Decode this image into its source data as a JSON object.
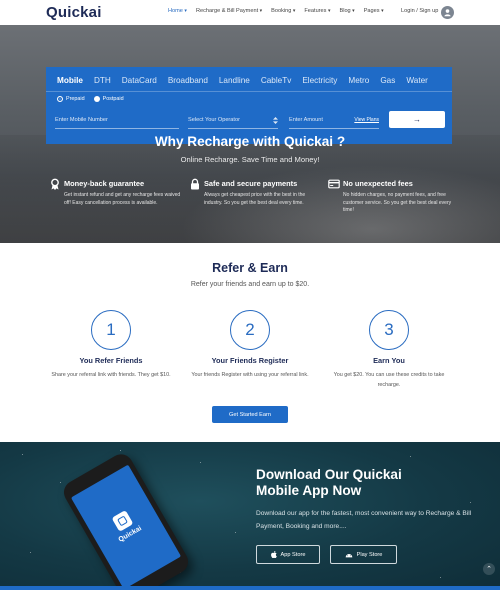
{
  "header": {
    "logo": "Quickai",
    "nav": [
      {
        "label": "Home",
        "caret": "▾",
        "active": true
      },
      {
        "label": "Recharge & Bill Payment",
        "caret": "▾"
      },
      {
        "label": "Booking",
        "caret": "▾"
      },
      {
        "label": "Features",
        "caret": "▾"
      },
      {
        "label": "Blog",
        "caret": "▾"
      },
      {
        "label": "Pages",
        "caret": "▾"
      }
    ],
    "login": "Login / Sign up"
  },
  "recharge_panel": {
    "tabs": [
      "Mobile",
      "DTH",
      "DataCard",
      "Broadband",
      "Landline",
      "CableTv",
      "Electricity",
      "Metro",
      "Gas",
      "Water"
    ],
    "active_tab": "Mobile",
    "radios": [
      {
        "label": "Prepaid",
        "checked": true
      },
      {
        "label": "Postpaid",
        "checked": false
      }
    ],
    "mobile_placeholder": "Enter Mobile Number",
    "operator_placeholder": "Select Your Operator",
    "amount_placeholder": "Enter Amount",
    "view_plans": "View Plans",
    "submit_arrow": "→"
  },
  "why": {
    "title": "Why Recharge with Quickai ?",
    "subtitle": "Online Recharge. Save Time and Money!",
    "features": [
      {
        "title": "Money-back guarantee",
        "desc": "Get instant refund and get any recharge fees waived off! Easy cancellation process is available."
      },
      {
        "title": "Safe and secure payments",
        "desc": "Always get cheapest price with the best in the industry. So you get the best deal every time."
      },
      {
        "title": "No unexpected fees",
        "desc": "No hidden charges, no payment fees, and free customer service. So you get the best deal every time!"
      }
    ]
  },
  "refer": {
    "title": "Refer & Earn",
    "subtitle": "Refer your friends and earn up to $20.",
    "steps": [
      {
        "num": "1",
        "title": "You Refer Friends",
        "desc": "Share your referral link with friends. They get $10."
      },
      {
        "num": "2",
        "title": "Your Friends Register",
        "desc": "Your friends Register with using your referral link."
      },
      {
        "num": "3",
        "title": "Earn You",
        "desc": "You get $20. You can use these credits to take recharge."
      }
    ],
    "cta": "Get Started Earn"
  },
  "app": {
    "title_line1": "Download Our Quickai",
    "title_line2": "Mobile App Now",
    "desc": "Download our app for the fastest, most convenient way to Recharge & Bill Payment, Booking and more....",
    "phone_name": "Quickai",
    "app_store": "App Store",
    "play_store": "Play Store",
    "to_top": "⌃"
  },
  "colors": {
    "primary": "#1f6bc7",
    "navy": "#1e2b57",
    "app_bg": "#143945"
  }
}
